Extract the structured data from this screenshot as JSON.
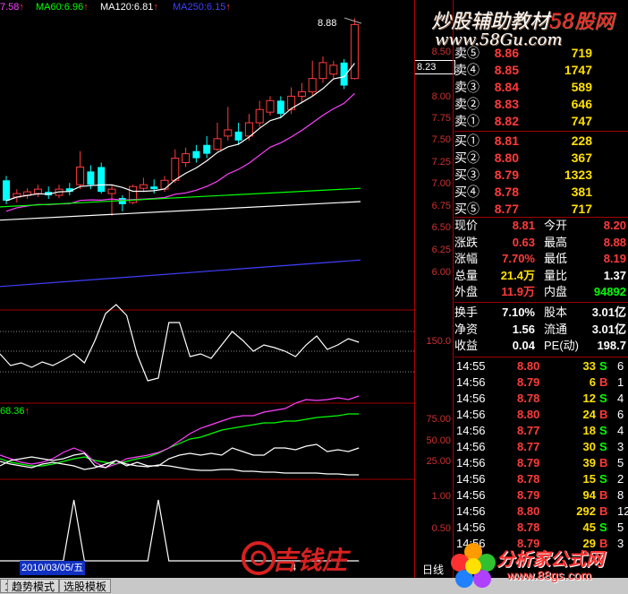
{
  "header": {
    "ma_items": [
      {
        "text": "7.58",
        "color": "#ff40ff",
        "arrow": "↑"
      },
      {
        "text": "MA60:6.96",
        "color": "#00ff00",
        "arrow": "↑"
      },
      {
        "text": "MA120:6.81",
        "color": "#ffffff",
        "arrow": "↑"
      },
      {
        "text": "MA250:6.15",
        "color": "#4040ff",
        "arrow": "↑"
      }
    ]
  },
  "main_chart": {
    "high_label": "8.88",
    "price_tag": "8.23",
    "y_ticks": [
      "8.50",
      "8.25",
      "8.00",
      "7.75",
      "7.50",
      "7.25",
      "7.00",
      "6.75",
      "6.50",
      "6.25",
      "6.00"
    ]
  },
  "sub1": {
    "y_label": "150.0"
  },
  "sub2": {
    "value_label": "68.36",
    "arrow": "↑",
    "y_ticks": [
      "75.00",
      "50.00",
      "25.00"
    ]
  },
  "sub3": {
    "y_ticks": [
      "1.00",
      "0.50"
    ]
  },
  "date_label": "2010/03/05/五",
  "period_label": "日线",
  "x_marker": "4",
  "order_book": {
    "asks": [
      {
        "label": "卖⑤",
        "price": "8.86",
        "vol": "719"
      },
      {
        "label": "卖④",
        "price": "8.85",
        "vol": "1747"
      },
      {
        "label": "卖③",
        "price": "8.84",
        "vol": "589"
      },
      {
        "label": "卖②",
        "price": "8.83",
        "vol": "646"
      },
      {
        "label": "卖①",
        "price": "8.82",
        "vol": "747"
      }
    ],
    "bids": [
      {
        "label": "买①",
        "price": "8.81",
        "vol": "228"
      },
      {
        "label": "买②",
        "price": "8.80",
        "vol": "367"
      },
      {
        "label": "买③",
        "price": "8.79",
        "vol": "1323"
      },
      {
        "label": "买④",
        "price": "8.78",
        "vol": "381"
      },
      {
        "label": "买⑤",
        "price": "8.77",
        "vol": "717"
      }
    ]
  },
  "quote": {
    "rows": [
      {
        "l1": "现价",
        "v1": "8.81",
        "l2": "今开",
        "v2": "8.20",
        "c1": "#ff3b3b",
        "c2": "#ff3b3b"
      },
      {
        "l1": "涨跌",
        "v1": "0.63",
        "l2": "最高",
        "v2": "8.88",
        "c1": "#ff3b3b",
        "c2": "#ff3b3b"
      },
      {
        "l1": "涨幅",
        "v1": "7.70%",
        "l2": "最低",
        "v2": "8.19",
        "c1": "#ff3b3b",
        "c2": "#ff3b3b"
      },
      {
        "l1": "总量",
        "v1": "21.4万",
        "l2": "量比",
        "v2": "1.37",
        "c1": "#ffe000",
        "c2": "#ffffff"
      },
      {
        "l1": "外盘",
        "v1": "11.9万",
        "l2": "内盘",
        "v2": "94892",
        "c1": "#ff3b3b",
        "c2": "#00ff00"
      }
    ]
  },
  "finance": {
    "rows": [
      {
        "l1": "换手",
        "v1": "7.10%",
        "l2": "股本",
        "v2": "3.01亿"
      },
      {
        "l1": "净资",
        "v1": "1.56",
        "l2": "流通",
        "v2": "3.01亿"
      },
      {
        "l1": "收益",
        "v1": "0.04",
        "l2": "PE(动)",
        "v2": "198.7"
      }
    ]
  },
  "trades": [
    {
      "time": "14:55",
      "price": "8.80",
      "vol": "33",
      "bs": "S",
      "n": "6"
    },
    {
      "time": "14:56",
      "price": "8.79",
      "vol": "6",
      "bs": "B",
      "n": "1"
    },
    {
      "time": "14:56",
      "price": "8.78",
      "vol": "12",
      "bs": "S",
      "n": "4"
    },
    {
      "time": "14:56",
      "price": "8.80",
      "vol": "24",
      "bs": "B",
      "n": "6"
    },
    {
      "time": "14:56",
      "price": "8.77",
      "vol": "18",
      "bs": "S",
      "n": "4"
    },
    {
      "time": "14:56",
      "price": "8.77",
      "vol": "30",
      "bs": "S",
      "n": "3"
    },
    {
      "time": "14:56",
      "price": "8.79",
      "vol": "39",
      "bs": "B",
      "n": "5"
    },
    {
      "time": "14:56",
      "price": "8.78",
      "vol": "15",
      "bs": "S",
      "n": "2"
    },
    {
      "time": "14:56",
      "price": "8.79",
      "vol": "94",
      "bs": "B",
      "n": "8"
    },
    {
      "time": "14:56",
      "price": "8.80",
      "vol": "292",
      "bs": "B",
      "n": "12"
    },
    {
      "time": "14:56",
      "price": "8.78",
      "vol": "45",
      "bs": "S",
      "n": "5"
    },
    {
      "time": "14:56",
      "price": "8.79",
      "vol": "29",
      "bs": "B",
      "n": "3"
    }
  ],
  "bottom_bar": {
    "items": [
      "1",
      "趋势模式",
      "选股模板"
    ]
  },
  "watermarks": {
    "top_line1_a": "炒股辅助教材",
    "top_line1_b": "58股网",
    "top_line2": "www.58Gu.com",
    "logo_text": "吉钱庄",
    "site_text": "分析家公式网",
    "site_url": "www.88gs.com"
  },
  "colors": {
    "up": "#ff3b3b",
    "down": "#00ffff",
    "grid": "#a00000",
    "ma_purple": "#ff40ff",
    "ma_green": "#00ff00",
    "ma_white": "#ffffff",
    "ma_blue": "#4040ff"
  },
  "candles": [
    {
      "o": 7.05,
      "c": 6.82,
      "h": 7.1,
      "l": 6.78
    },
    {
      "o": 6.86,
      "c": 6.9,
      "h": 6.95,
      "l": 6.8
    },
    {
      "o": 6.88,
      "c": 6.92,
      "h": 6.96,
      "l": 6.84
    },
    {
      "o": 6.9,
      "c": 6.95,
      "h": 7.0,
      "l": 6.86
    },
    {
      "o": 6.92,
      "c": 6.88,
      "h": 6.98,
      "l": 6.84
    },
    {
      "o": 6.88,
      "c": 6.95,
      "h": 7.0,
      "l": 6.85
    },
    {
      "o": 6.96,
      "c": 6.92,
      "h": 7.02,
      "l": 6.88
    },
    {
      "o": 7.0,
      "c": 7.2,
      "h": 7.38,
      "l": 6.95
    },
    {
      "o": 7.15,
      "c": 7.0,
      "h": 7.22,
      "l": 6.95
    },
    {
      "o": 7.2,
      "c": 6.92,
      "h": 7.25,
      "l": 6.9
    },
    {
      "o": 6.9,
      "c": 6.95,
      "h": 7.0,
      "l": 6.65
    },
    {
      "o": 6.85,
      "c": 6.78,
      "h": 6.88,
      "l": 6.7
    },
    {
      "o": 6.8,
      "c": 6.98,
      "h": 7.0,
      "l": 6.78
    },
    {
      "o": 6.96,
      "c": 7.0,
      "h": 7.08,
      "l": 6.92
    },
    {
      "o": 6.98,
      "c": 6.95,
      "h": 7.06,
      "l": 6.9
    },
    {
      "o": 6.95,
      "c": 7.05,
      "h": 7.1,
      "l": 6.92
    },
    {
      "o": 7.05,
      "c": 7.3,
      "h": 7.4,
      "l": 7.02
    },
    {
      "o": 7.25,
      "c": 7.35,
      "h": 7.42,
      "l": 7.2
    },
    {
      "o": 7.38,
      "c": 7.3,
      "h": 7.45,
      "l": 7.25
    },
    {
      "o": 7.45,
      "c": 7.35,
      "h": 7.55,
      "l": 7.3
    },
    {
      "o": 7.4,
      "c": 7.52,
      "h": 7.7,
      "l": 7.38
    },
    {
      "o": 7.55,
      "c": 7.62,
      "h": 7.88,
      "l": 7.5
    },
    {
      "o": 7.6,
      "c": 7.5,
      "h": 7.7,
      "l": 7.45
    },
    {
      "o": 7.55,
      "c": 7.7,
      "h": 7.8,
      "l": 7.5
    },
    {
      "o": 7.7,
      "c": 7.85,
      "h": 7.95,
      "l": 7.65
    },
    {
      "o": 7.82,
      "c": 7.95,
      "h": 8.0,
      "l": 7.78
    },
    {
      "o": 7.95,
      "c": 7.8,
      "h": 8.0,
      "l": 7.75
    },
    {
      "o": 7.85,
      "c": 8.0,
      "h": 8.1,
      "l": 7.8
    },
    {
      "o": 8.0,
      "c": 8.05,
      "h": 8.15,
      "l": 7.92
    },
    {
      "o": 8.05,
      "c": 8.2,
      "h": 8.4,
      "l": 8.0
    },
    {
      "o": 8.2,
      "c": 8.38,
      "h": 8.45,
      "l": 8.15
    },
    {
      "o": 8.25,
      "c": 8.35,
      "h": 8.4,
      "l": 8.2
    },
    {
      "o": 8.38,
      "c": 8.12,
      "h": 8.42,
      "l": 8.08
    },
    {
      "o": 8.2,
      "c": 8.81,
      "h": 8.88,
      "l": 8.19
    }
  ]
}
